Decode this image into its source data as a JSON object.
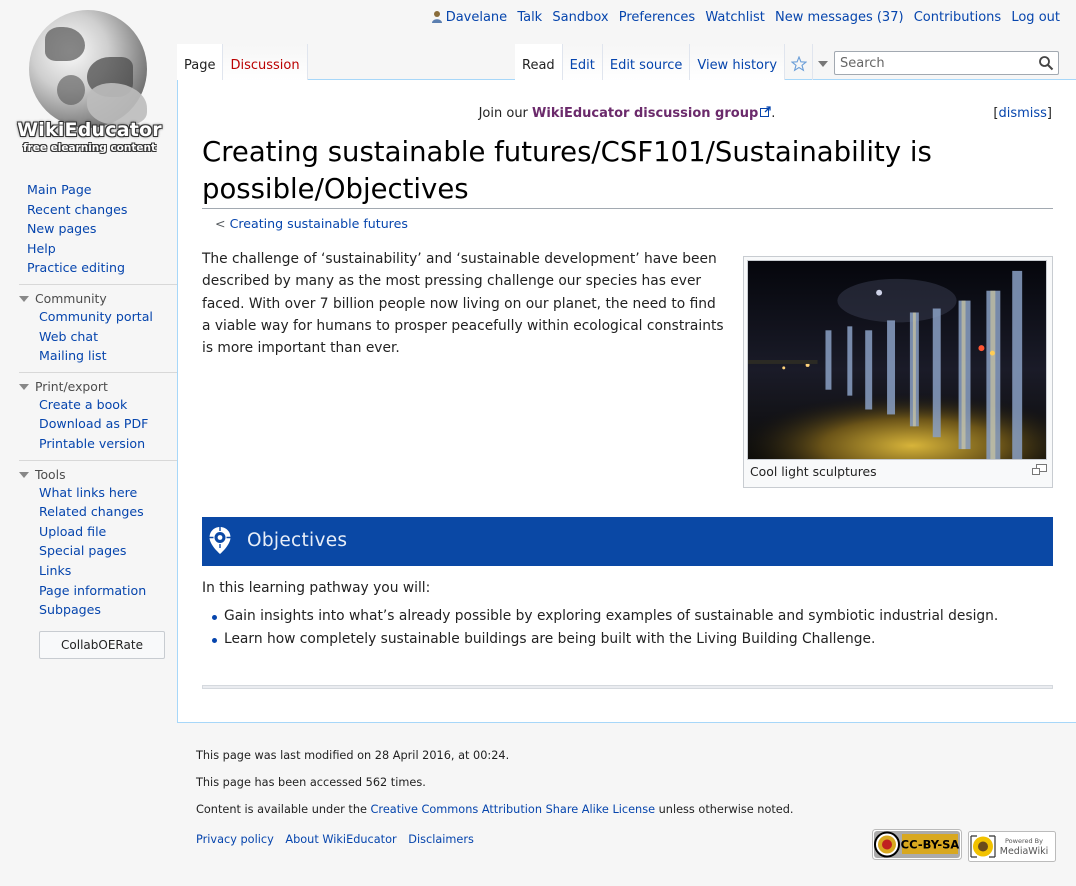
{
  "personal": {
    "user": "Davelane",
    "talk": "Talk",
    "sandbox": "Sandbox",
    "preferences": "Preferences",
    "watchlist": "Watchlist",
    "messages": "New messages (37)",
    "contributions": "Contributions",
    "logout": "Log out"
  },
  "logo": {
    "name": "WikiEducator",
    "tagline": "free elearning content"
  },
  "nav": {
    "main": [
      "Main Page",
      "Recent changes",
      "New pages",
      "Help",
      "Practice editing"
    ],
    "community": {
      "heading": "Community",
      "items": [
        "Community portal",
        "Web chat",
        "Mailing list"
      ]
    },
    "print": {
      "heading": "Print/export",
      "items": [
        "Create a book",
        "Download as PDF",
        "Printable version"
      ]
    },
    "tools": {
      "heading": "Tools",
      "items": [
        "What links here",
        "Related changes",
        "Upload file",
        "Special pages",
        "Links",
        "Page information",
        "Subpages"
      ]
    },
    "collab_button": "CollabOERate"
  },
  "tabs": {
    "page": "Page",
    "discussion": "Discussion",
    "read": "Read",
    "edit": "Edit",
    "edit_source": "Edit source",
    "history": "View history"
  },
  "search": {
    "placeholder": "Search"
  },
  "notice": {
    "prefix": "Join our ",
    "link": "WikiEducator discussion group",
    "suffix": ".",
    "dismiss_open": "[",
    "dismiss": "dismiss",
    "dismiss_close": "]"
  },
  "article": {
    "title": "Creating sustainable futures/CSF101/Sustainability is possible/Objectives",
    "subpage_prefix": "< ",
    "subpage_link": "Creating sustainable futures",
    "intro": "The challenge of ‘sustainability’ and ‘sustainable development’ have been described by many as the most pressing challenge our species has ever faced. With over 7 billion people now living on our planet, the need to find a viable way for humans to prosper peacefully within ecological constraints is more important than ever.",
    "thumb_caption": "Cool light sculptures",
    "objectives_heading": "Objectives",
    "objectives_intro": "In this learning pathway you will:",
    "objectives": [
      "Gain insights into what’s already possible by exploring examples of sustainable and symbiotic industrial design.",
      "Learn how completely sustainable buildings are being built with the Living Building Challenge."
    ]
  },
  "footer": {
    "modified": "This page was last modified on 28 April 2016, at 00:24.",
    "accessed": "This page has been accessed 562 times.",
    "content_prefix": "Content is available under the ",
    "license": "Creative Commons Attribution Share Alike License",
    "content_suffix": " unless otherwise noted.",
    "places": [
      "Privacy policy",
      "About WikiEducator",
      "Disclaimers"
    ],
    "cc_badge": "CC-BY-SA",
    "mw_badge_top": "Powered By",
    "mw_badge": "MediaWiki"
  },
  "colors": {
    "link": "#0645ad",
    "talk_link": "#ba0000",
    "banner": "#0a48a5"
  }
}
